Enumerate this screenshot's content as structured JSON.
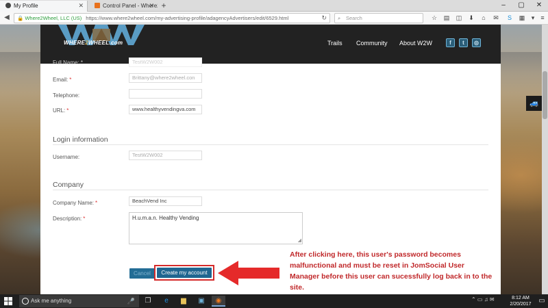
{
  "browser": {
    "tabs": [
      {
        "title": "My Profile",
        "active": true
      },
      {
        "title": "Control Panel - Where2W...",
        "active": false
      }
    ],
    "new_tab": "+",
    "window_controls": [
      "–",
      "▢",
      "✕"
    ],
    "org_label": "Where2Wheel, LLC (US)",
    "url": "https://www.where2wheel.com/my-advertising-profile/adagencyAdvertisers/edit/6529.html",
    "search_placeholder": "Search"
  },
  "site": {
    "logo_left": "WHERE",
    "logo_mid": "2",
    "logo_right": "WHEEL.com",
    "nav": [
      "Trails",
      "Community",
      "About W2W"
    ],
    "social": [
      "f",
      "t",
      "◎"
    ]
  },
  "form": {
    "faded_top_label": "Full Name: *",
    "faded_top_value": "TestW2W002",
    "fields": [
      {
        "label": "Email:",
        "required": true,
        "value": "Brittany@where2wheel.con",
        "placeholder": true
      },
      {
        "label": "Telephone:",
        "required": false,
        "value": "",
        "placeholder": false
      },
      {
        "label": "URL:",
        "required": true,
        "value": "www.healthyvendingva.com",
        "placeholder": false
      }
    ],
    "login_section": "Login information",
    "username_label": "Username:",
    "username_value": "TestW2W002",
    "company_section": "Company",
    "company_label": "Company Name:",
    "company_value": "BeachVend Inc",
    "description_label": "Description:",
    "description_value": "H.u.m.a.n. Healthy Vending",
    "cancel_label": "Cancel",
    "create_label": "Create my account",
    "required_mark": "*"
  },
  "annotation": {
    "text": "After clicking here, this user's password becomes malfunctional and must be reset in JomSocial User Manager before this user can sucessfully log back in to the site.",
    "color": "#c0282a"
  },
  "taskbar": {
    "search_placeholder": "Ask me anything",
    "time": "8:12 AM",
    "date": "2/20/2017"
  }
}
